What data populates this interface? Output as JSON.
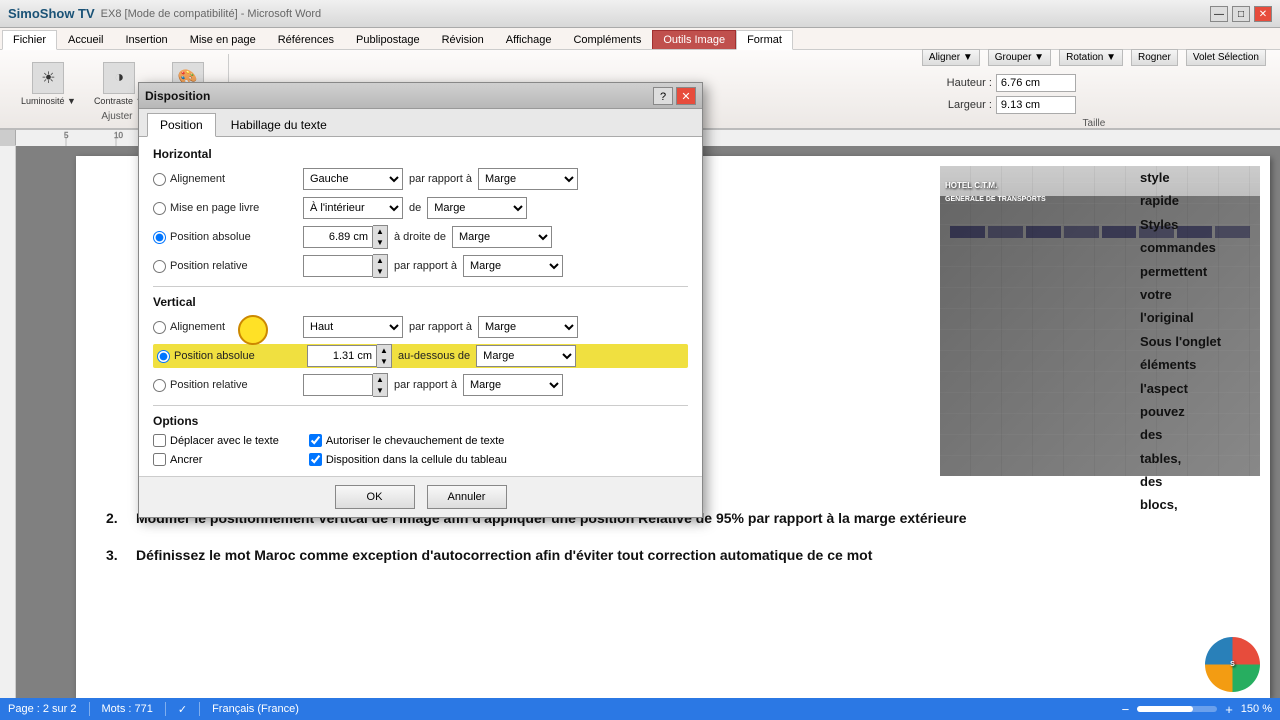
{
  "titlebar": {
    "brand": "SimoShow TV",
    "title": "EX8 [Mode de compatibilité] - Microsoft Word",
    "outils_image": "Outils Image",
    "format_tab": "Format",
    "min": "—",
    "max": "□",
    "close": "✕"
  },
  "ribbon_tabs": {
    "fichier": "Fichier",
    "accueil": "Accueil",
    "insertion": "Insertion",
    "mise_en_page": "Mise en page",
    "references": "Références",
    "publipostage": "Publipostage",
    "revision": "Révision",
    "affichage": "Affichage",
    "complements": "Compléments",
    "outils_image": "Outils Image",
    "format": "Format"
  },
  "ribbon": {
    "aligner": "Aligner ▼",
    "grouper": "Grouper ▼",
    "rotation": "Rotation ▼",
    "volet_selection": "Volet\nSélection",
    "hauteur_label": "Hauteur :",
    "hauteur_val": "6.76 cm",
    "largeur_label": "Largeur :",
    "largeur_val": "9.13 cm",
    "taille_label": "Taille",
    "rogner": "Rogner"
  },
  "dialog": {
    "title": "Disposition",
    "tab_position": "Position",
    "tab_habillage": "Habillage du texte",
    "section_horizontal": "Horizontal",
    "section_vertical": "Vertical",
    "section_options": "Options",
    "alignement_label": "Alignement",
    "mise_en_page_label": "Mise en page livre",
    "position_absolue_label": "Position absolue",
    "position_relative_label": "Position relative",
    "alignement_v_label": "Alignement",
    "position_absolue_v_label": "Position absolue",
    "position_relative_v_label": "Position relative",
    "par_rapport_a": "par rapport à",
    "a_droite_de": "à droite de",
    "de": "de",
    "au_dessous_de": "au-dessous de",
    "align_gauche": "Gauche",
    "marge": "Marge",
    "a_interieur": "À l'intérieur",
    "pos_abs_h_val": "6.89 cm",
    "pos_abs_v_val": "1.31 cm",
    "haut": "Haut",
    "deplacer_texte": "Déplacer avec le texte",
    "ancrer": "Ancrer",
    "autoriser_chevauchement": "Autoriser le chevauchement de texte",
    "disposition_cellule": "Disposition dans la cellule du tableau",
    "ok": "OK",
    "annuler": "Annuler",
    "close_btn": "✕",
    "help_btn": "?"
  },
  "document": {
    "text_right_1": "style",
    "text_right_2": "rapide",
    "text_right_3": "Styles",
    "text_right_4": "commandes",
    "text_right_5": "permettent",
    "text_right_6": "votre",
    "text_right_7": "l'original",
    "text_right_8": "Sous l'onglet",
    "text_right_9": "éléments",
    "text_right_10": "l'aspect",
    "text_right_11": "pouvez",
    "text_right_12": "des",
    "text_right_13": "tables,",
    "text_right_14": "des",
    "text_right_15": "blocs,",
    "item2_num": "2.",
    "item2_text": "Modifier le positionnement Vertical de l'image afin d'appliquer une position Relative de 95%  par rapport à la marge extérieure",
    "item3_num": "3.",
    "item3_text": "Définissez le mot Maroc comme exception d'autocorrection afin d'éviter tout correction automatique de ce mot"
  },
  "statusbar": {
    "page": "Page : 2 sur 2",
    "mots": "Mots : 771",
    "langue": "Français (France)",
    "zoom_pct": "150 %"
  }
}
